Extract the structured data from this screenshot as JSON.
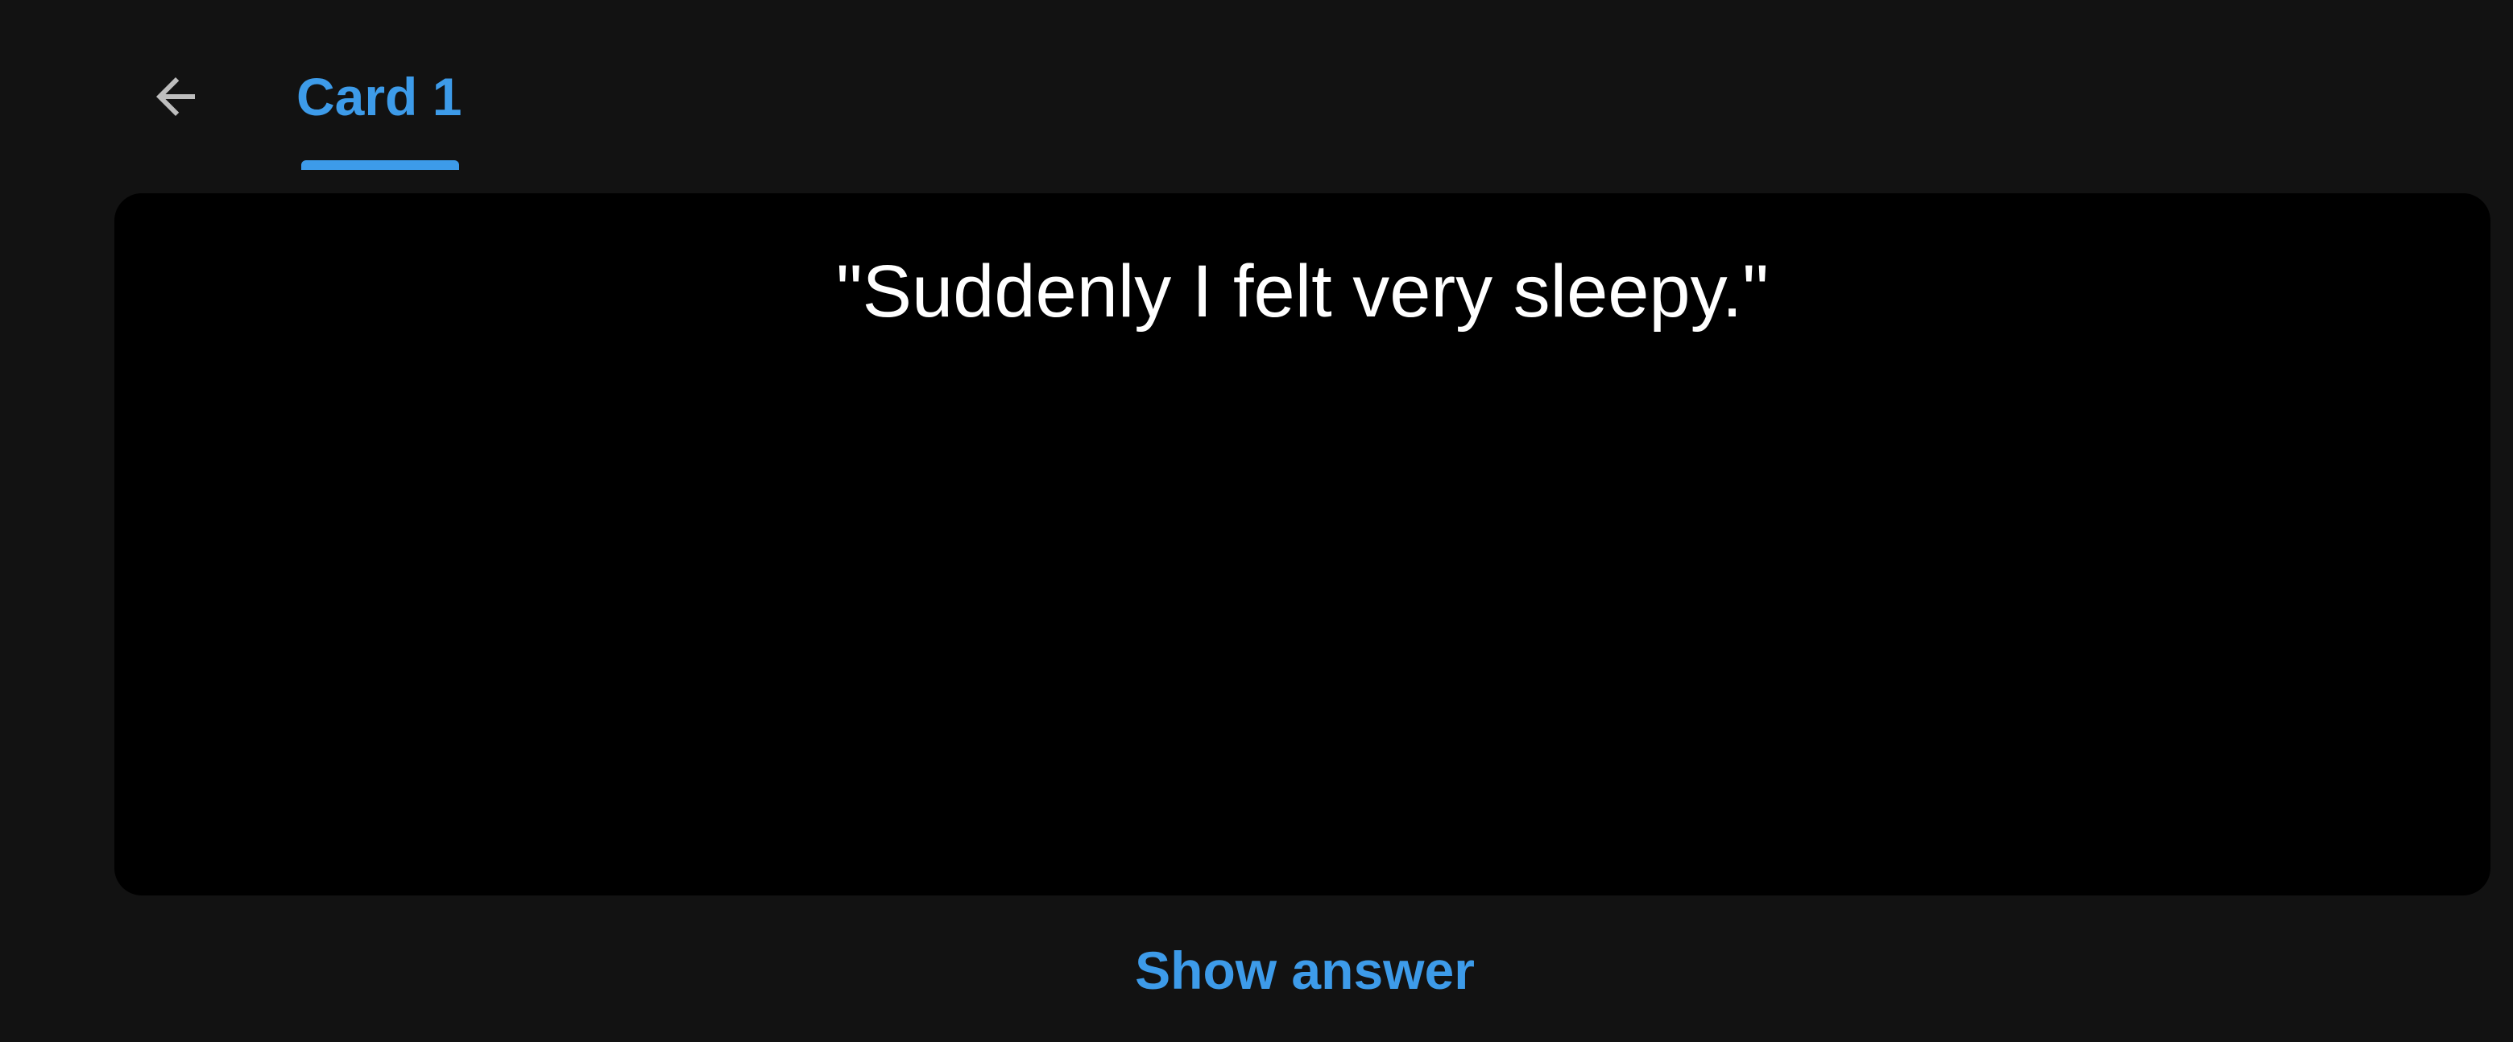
{
  "header": {
    "back_icon": "arrow-left-icon",
    "tabs": [
      {
        "label": "Card 1",
        "selected": true
      }
    ]
  },
  "card": {
    "front_text": "\"Suddenly I felt very sleepy.\""
  },
  "actions": {
    "show_answer_label": "Show answer"
  },
  "colors": {
    "background": "#121212",
    "card": "#000000",
    "accent": "#3d9be9",
    "text": "#ffffff",
    "icon": "#bdbdbd"
  }
}
